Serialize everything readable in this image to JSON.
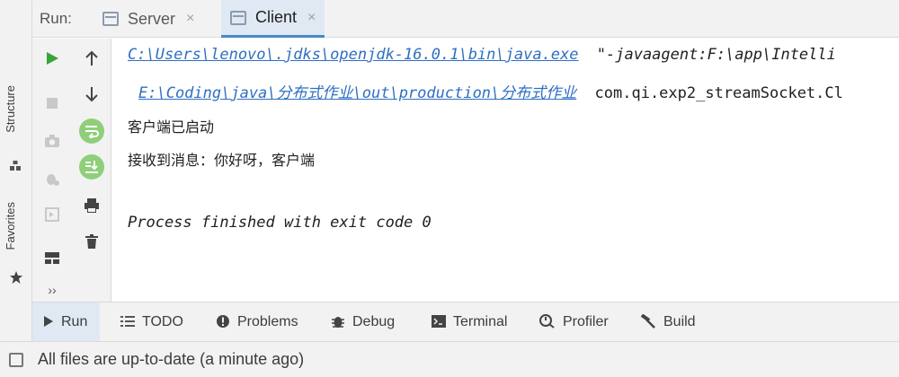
{
  "window": {
    "run_label": "Run:",
    "tabs": [
      {
        "label": "Server",
        "close": "×",
        "active": false
      },
      {
        "label": "Client",
        "close": "×",
        "active": true
      }
    ]
  },
  "left_strip": {
    "structure_label": "Structure",
    "favorites_label": "Favorites"
  },
  "toolbar": {
    "expand_label": "››"
  },
  "console": {
    "line1_path": "C:\\Users\\lenovo\\.jdks\\openjdk-16.0.1\\bin\\java.exe",
    "line1_arg": "\"-javaagent:F:\\app\\Intelli",
    "line2_path": "E:\\Coding\\java\\分布式作业\\out\\production\\分布式作业",
    "line2_arg": "com.qi.exp2_streamSocket.Cl",
    "line3": "客户端已启动",
    "line4": "接收到消息：你好呀，客户端",
    "line5": "Process finished with exit code 0"
  },
  "bottom_tabs": [
    {
      "label": "Run",
      "icon": "play-icon",
      "active": true
    },
    {
      "label": "TODO",
      "icon": "list-icon",
      "active": false
    },
    {
      "label": "Problems",
      "icon": "alert-icon",
      "active": false
    },
    {
      "label": "Debug",
      "icon": "bug-icon",
      "active": false
    },
    {
      "label": "Terminal",
      "icon": "terminal-icon",
      "active": false
    },
    {
      "label": "Profiler",
      "icon": "profiler-icon",
      "active": false
    },
    {
      "label": "Build",
      "icon": "hammer-icon",
      "active": false
    }
  ],
  "status": {
    "text": "All files are up-to-date (a minute ago)"
  },
  "colors": {
    "link": "#2f6fc3",
    "run_green": "#3aa33a",
    "active_tab_bg": "#dfe8f3",
    "active_tab_underline": "#4a88c7"
  }
}
